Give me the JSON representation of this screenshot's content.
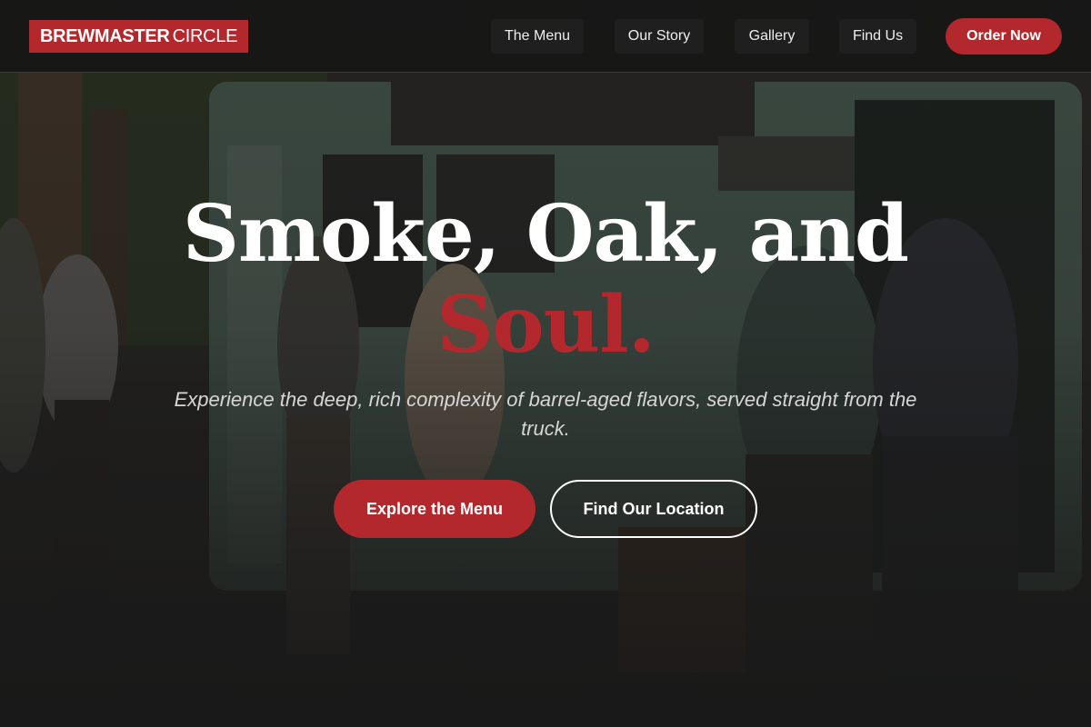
{
  "brand": {
    "name_bold": "BREWMASTER",
    "name_light": "CIRCLE",
    "accent": "#b3282d"
  },
  "nav": {
    "items": [
      {
        "label": "The Menu"
      },
      {
        "label": "Our Story"
      },
      {
        "label": "Gallery"
      },
      {
        "label": "Find Us"
      }
    ],
    "order_label": "Order Now"
  },
  "hero": {
    "title_line1": "Smoke, Oak, and",
    "title_line2": "Soul.",
    "subtitle": "Experience the deep, rich complexity of barrel-aged flavors, served straight from the truck.",
    "primary_cta": "Explore the Menu",
    "secondary_cta": "Find Our Location",
    "background_photo": "food-truck-crowd-photo"
  }
}
